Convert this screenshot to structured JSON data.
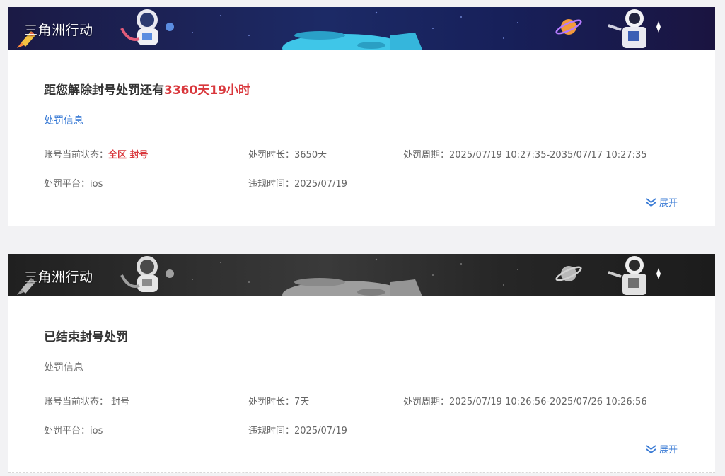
{
  "records": [
    {
      "game_name": "三角洲行动",
      "headline_prefix": "距您解除封号处罚还有",
      "headline_remaining": "3360天19小时",
      "section_label": "处罚信息",
      "status_label": "账号当前状态：",
      "status_value": "全区 封号",
      "duration_label": "处罚时长：",
      "duration_value": "3650天",
      "period_label": "处罚周期：",
      "period_value": "2025/07/19 10:27:35-2035/07/17 10:27:35",
      "platform_label": "处罚平台：",
      "platform_value": "ios",
      "violation_label": "违规时间：",
      "violation_value": "2025/07/19",
      "expand_label": "展开",
      "active": true
    },
    {
      "game_name": "三角洲行动",
      "headline": "已结束封号处罚",
      "section_label": "处罚信息",
      "status_label": "账号当前状态：",
      "status_value": "封号",
      "duration_label": "处罚时长：",
      "duration_value": "7天",
      "period_label": "处罚周期：",
      "period_value": "2025/07/19 10:26:56-2025/07/26 10:26:56",
      "platform_label": "处罚平台：",
      "platform_value": "ios",
      "violation_label": "违规时间：",
      "violation_value": "2025/07/19",
      "expand_label": "展开",
      "active": false
    }
  ],
  "colors": {
    "accent_blue": "#3a7bd5",
    "alert_red": "#d9373c",
    "banner_active": "#1c1a4a",
    "banner_inactive": "#1e1e1e"
  },
  "icons": [
    "rocket-icon",
    "astronaut-icon",
    "spaceship-icon",
    "planet-icon",
    "astronaut-flag-icon",
    "chevron-double-down-icon"
  ]
}
